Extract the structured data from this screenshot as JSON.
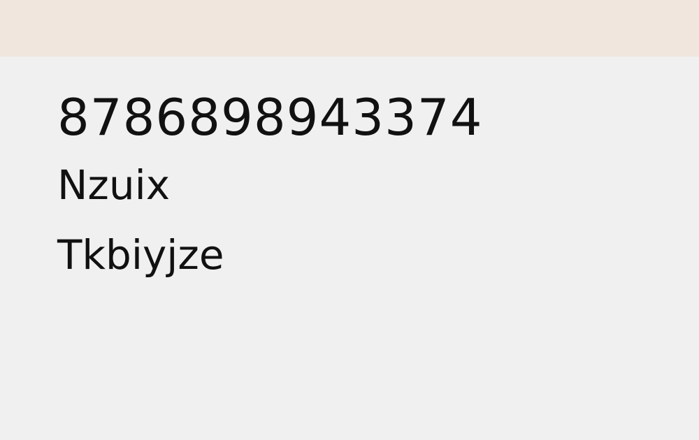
{
  "header": {
    "background": "#f0e6de"
  },
  "main": {
    "background": "#f0f0f0",
    "text_color": "#111111",
    "lines": [
      "8786898943374",
      "Nzuix",
      "Tkbiyjze"
    ]
  }
}
